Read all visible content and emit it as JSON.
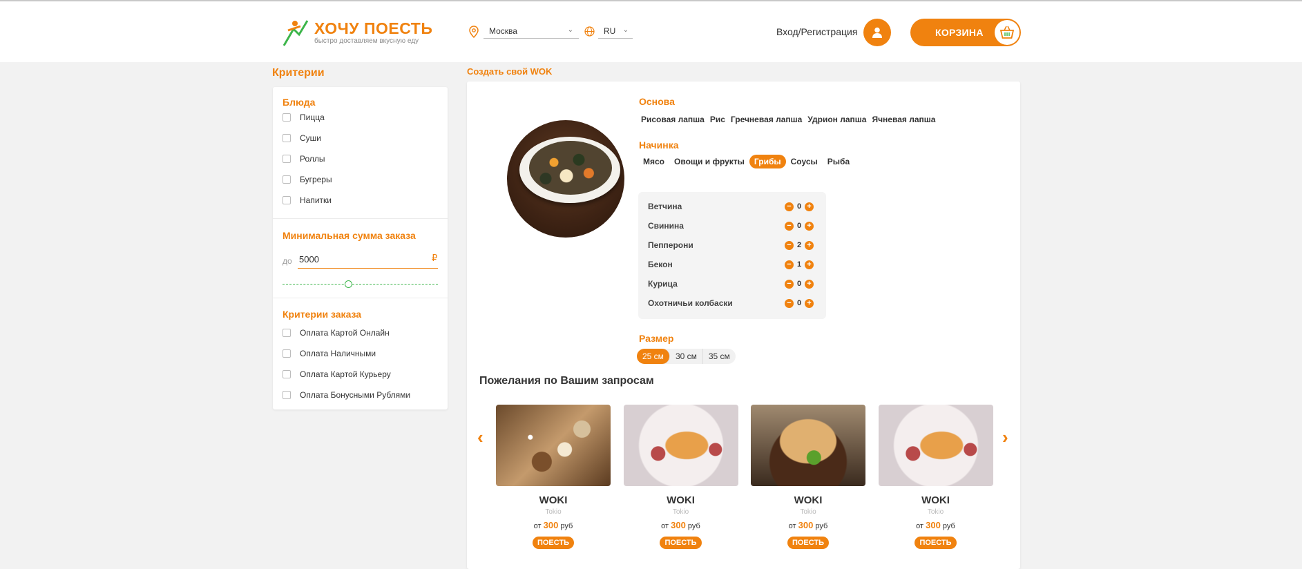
{
  "header": {
    "logo_title": "ХОЧУ ПОЕСТЬ",
    "logo_subtitle": "быстро доставляем вкусную еду",
    "city": "Москва",
    "lang": "RU",
    "login_text": "Вход/Регистрация",
    "cart_label": "КОРЗИНА"
  },
  "sidebar": {
    "title": "Критерии",
    "dishes_title": "Блюда",
    "dishes": [
      "Пицца",
      "Суши",
      "Роллы",
      "Бугреры",
      "Напитки"
    ],
    "min_sum_title": "Минимальная сумма заказа",
    "min_sum_prefix": "до",
    "min_sum_value": "5000",
    "currency": "₽",
    "slider_level": 0.42,
    "order_title": "Критерии заказа",
    "order_criteria": [
      "Оплата Картой Онлайн",
      "Оплата Наличными",
      "Оплата Картой Курьеру",
      "Оплата Бонусными Рублями"
    ]
  },
  "main": {
    "title": "Создать свой WOK",
    "base_title": "Основа",
    "bases": [
      "Рисовая лапша",
      "Рис",
      "Гречневая лапша",
      "Удрион лапша",
      "Ячневая лапша"
    ],
    "filling_title": "Начинка",
    "fillings": [
      "Мясо",
      "Овощи и фрукты",
      "Грибы",
      "Соусы",
      "Рыба"
    ],
    "active_filling": "Грибы",
    "ingredients": [
      {
        "name": "Ветчина",
        "qty": "0"
      },
      {
        "name": "Свинина",
        "qty": "0"
      },
      {
        "name": "Пепперони",
        "qty": "2"
      },
      {
        "name": "Бекон",
        "qty": "1"
      },
      {
        "name": "Курица",
        "qty": "0"
      },
      {
        "name": "Охотничьи колбаски",
        "qty": "0"
      }
    ],
    "size_title": "Размер",
    "sizes": [
      "25 см",
      "30 см",
      "35 см"
    ],
    "active_size": "25 см",
    "wishes_title": "Пожелания по Вашим запросам",
    "cards": [
      {
        "name": "WOKI",
        "sub": "Tokio",
        "price_prefix": "от",
        "price": "300",
        "price_suffix": "руб",
        "button": "ПОЕСТЬ",
        "image": "salad"
      },
      {
        "name": "WOKI",
        "sub": "Tokio",
        "price_prefix": "от",
        "price": "300",
        "price_suffix": "руб",
        "button": "ПОЕСТЬ",
        "image": "croissant"
      },
      {
        "name": "WOKI",
        "sub": "Tokio",
        "price_prefix": "от",
        "price": "300",
        "price_suffix": "руб",
        "button": "ПОЕСТЬ",
        "image": "burger"
      },
      {
        "name": "WOKI",
        "sub": "Tokio",
        "price_prefix": "от",
        "price": "300",
        "price_suffix": "руб",
        "button": "ПОЕСТЬ",
        "image": "croissant"
      }
    ],
    "prev_arrow": "‹",
    "next_arrow": "›"
  },
  "colors": {
    "accent": "#f0820f",
    "green": "#3cb54a"
  }
}
